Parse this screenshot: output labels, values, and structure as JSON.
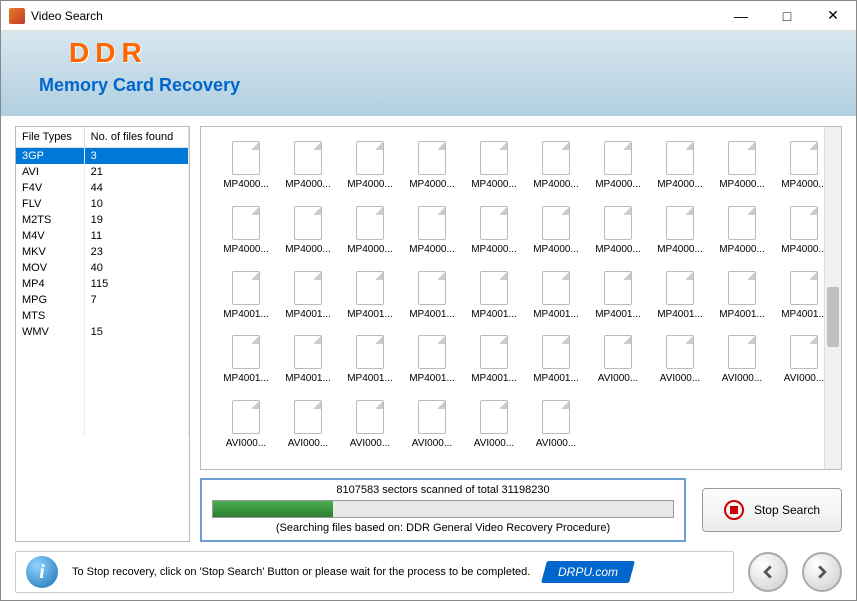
{
  "window": {
    "title": "Video Search"
  },
  "header": {
    "logo": "DDR",
    "subtitle": "Memory Card Recovery"
  },
  "table": {
    "col1": "File Types",
    "col2": "No. of files found",
    "rows": [
      {
        "type": "3GP",
        "count": "3",
        "selected": true
      },
      {
        "type": "AVI",
        "count": "21"
      },
      {
        "type": "F4V",
        "count": "44"
      },
      {
        "type": "FLV",
        "count": "10"
      },
      {
        "type": "M2TS",
        "count": "19"
      },
      {
        "type": "M4V",
        "count": "11"
      },
      {
        "type": "MKV",
        "count": "23"
      },
      {
        "type": "MOV",
        "count": "40"
      },
      {
        "type": "MP4",
        "count": "115"
      },
      {
        "type": "MPG",
        "count": "7"
      },
      {
        "type": "MTS",
        "count": ""
      },
      {
        "type": "WMV",
        "count": "15"
      }
    ]
  },
  "files": [
    "MP4000...",
    "MP4000...",
    "MP4000...",
    "MP4000...",
    "MP4000...",
    "MP4000...",
    "MP4000...",
    "MP4000...",
    "MP4000...",
    "MP4000...",
    "MP4000...",
    "MP4000...",
    "MP4000...",
    "MP4000...",
    "MP4000...",
    "MP4000...",
    "MP4000...",
    "MP4000...",
    "MP4000...",
    "MP4000...",
    "MP4001...",
    "MP4001...",
    "MP4001...",
    "MP4001...",
    "MP4001...",
    "MP4001...",
    "MP4001...",
    "MP4001...",
    "MP4001...",
    "MP4001...",
    "MP4001...",
    "MP4001...",
    "MP4001...",
    "MP4001...",
    "MP4001...",
    "MP4001...",
    "AVI000...",
    "AVI000...",
    "AVI000...",
    "AVI000...",
    "AVI000...",
    "AVI000...",
    "AVI000...",
    "AVI000...",
    "AVI000...",
    "AVI000..."
  ],
  "progress": {
    "status": "8107583 sectors scanned of total 31198230",
    "percent": 26,
    "note": "(Searching files based on:  DDR General Video Recovery Procedure)"
  },
  "buttons": {
    "stop": "Stop Search"
  },
  "footer": {
    "hint": "To Stop recovery, click on 'Stop Search' Button or please wait for the process to be completed.",
    "brand": "DRPU.com"
  }
}
